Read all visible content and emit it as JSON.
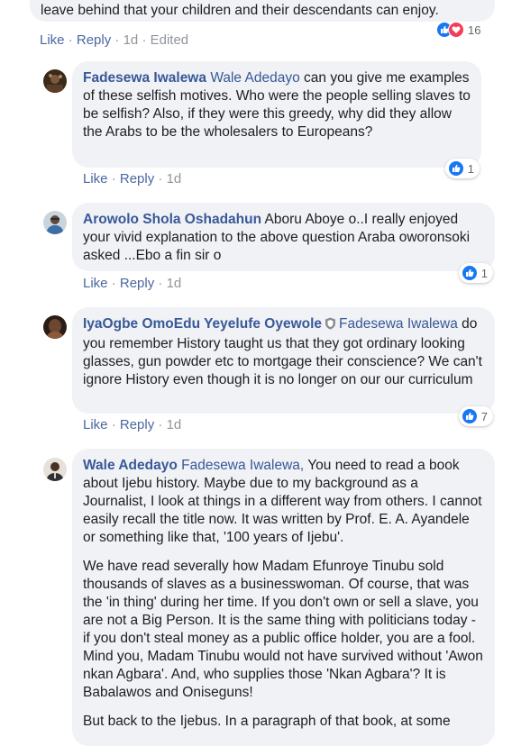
{
  "comments": [
    {
      "author": "",
      "mention": "",
      "text": "leave behind that your children and their descendants can enjoy.",
      "actions": {
        "like": "Like",
        "reply": "Reply",
        "time": "1d",
        "edited": "Edited"
      },
      "reactions": {
        "count": "16",
        "types": [
          "like",
          "love"
        ]
      }
    },
    {
      "author": "Fadesewa Iwalewa",
      "mention": "Wale Adedayo",
      "text": "can you give me examples of these selfish motives. Who were the people selling slaves to be selfish? Also, if they were this greedy, why did they allow the Arabs to be the wholesalers to Europeans?",
      "actions": {
        "like": "Like",
        "reply": "Reply",
        "time": "1d"
      },
      "reactions": {
        "count": "1",
        "types": [
          "like"
        ]
      }
    },
    {
      "author": "Arowolo Shola Oshadahun",
      "mention": "",
      "text": "Aboru Aboye o..I really enjoyed your vivid explanation to the above question Araba oworonsoki asked ...Ebo a fin sir o",
      "actions": {
        "like": "Like",
        "reply": "Reply",
        "time": "1d"
      },
      "reactions": {
        "count": "1",
        "types": [
          "like"
        ]
      }
    },
    {
      "author": "IyaOgbe OmoEdu Yeyelufe Oyewole",
      "mention": "Fadesewa Iwalewa",
      "text": "do you remember History taught us that they got ordinary looking glasses, gun powder etc to mortgage their conscience? We can't ignore History even though it is no longer on our our curriculum",
      "actions": {
        "like": "Like",
        "reply": "Reply",
        "time": "1d"
      },
      "reactions": {
        "count": "7",
        "types": [
          "like"
        ]
      }
    },
    {
      "author": "Wale Adedayo",
      "mention": "Fadesewa Iwalewa,",
      "text": "You need to read a book about Ijebu history. Maybe due to my background as a Journalist, I look at things in a different way from others. I cannot easily recall the title now. It was written by Prof. E. A. Ayandele or something like that, '100 years of Ijebu'.",
      "para2": "We have read severally how Madam Efunroye Tinubu sold thousands of slaves as a businesswoman. Of course, that was the 'in thing' during her time. If you don't own or sell a slave, you are not a Big Person. It is the same thing with politicians today - if you don't steal money as a public office holder, you are a fool. Mind you, Madam Tinubu would not have survived without 'Awon nkan Agbara'. And, who supplies those 'Nkan Agbara'? It is Babalawos and Oniseguns!",
      "para3": "But back to the Ijebus. In a paragraph of that book, at some"
    }
  ],
  "colors": {
    "name": "#385898",
    "bubble": "#f0f2f5",
    "like": "#1877f2",
    "love": "#f33e58"
  }
}
